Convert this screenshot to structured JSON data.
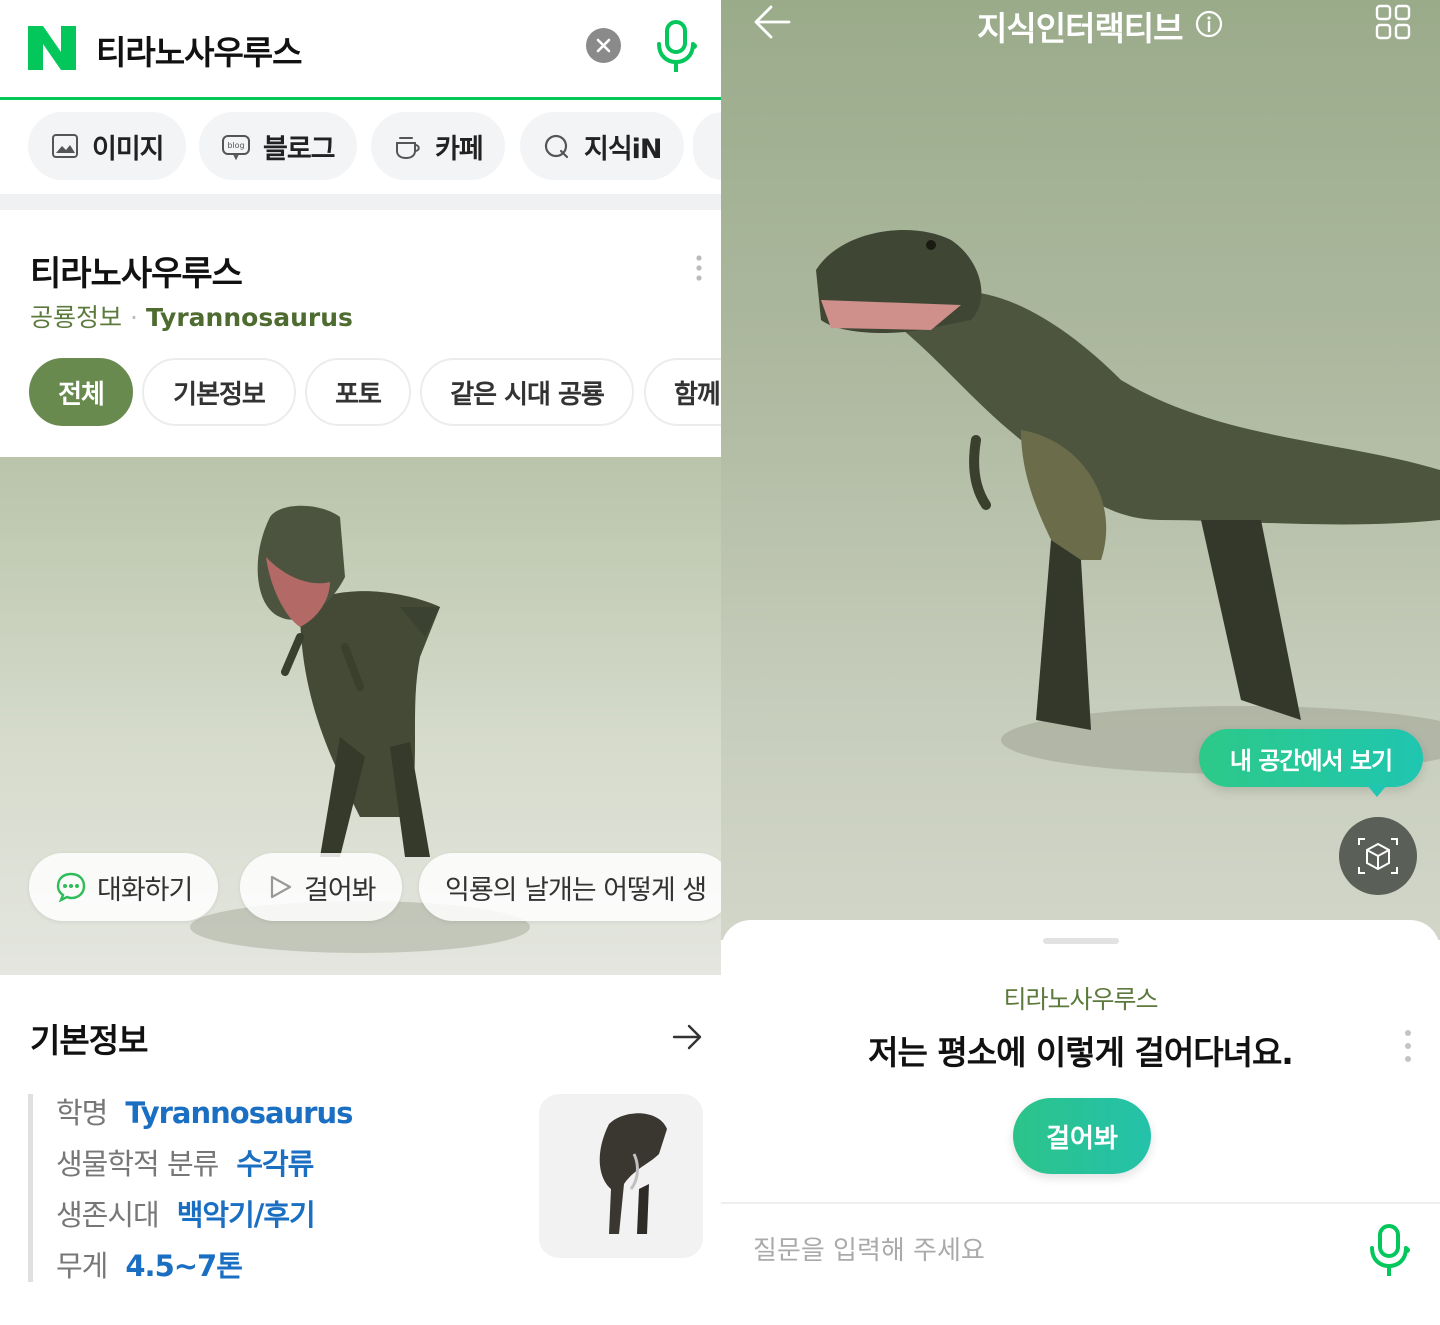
{
  "left": {
    "search": {
      "query": "티라노사우루스",
      "clear_icon": "close-icon",
      "mic_icon": "mic-icon"
    },
    "search_tabs": [
      {
        "label": "이미지",
        "icon": "image-icon"
      },
      {
        "label": "블로그",
        "icon": "blog-icon"
      },
      {
        "label": "카페",
        "icon": "cup-icon"
      },
      {
        "label": "지식iN",
        "icon": "q-icon"
      }
    ],
    "card": {
      "title": "티라노사우루스",
      "category": "공룡정보",
      "separator": "·",
      "english_name": "Tyrannosaurus",
      "tabs": [
        "전체",
        "기본정보",
        "포토",
        "같은 시대 공룡",
        "함께"
      ]
    },
    "dino_actions": [
      "대화하기",
      "걸어봐",
      "익룡의 날개는 어떻게 생"
    ],
    "basic_info": {
      "title": "기본정보",
      "rows": [
        {
          "key": "학명",
          "value": "Tyrannosaurus"
        },
        {
          "key": "생물학적 분류",
          "value": "수각류"
        },
        {
          "key": "생존시대",
          "value": "백악기/후기"
        },
        {
          "key": "무게",
          "value": "4.5~7톤"
        }
      ]
    }
  },
  "right": {
    "header": {
      "title": "지식인터랙티브"
    },
    "tooltip": "내 공간에서 보기",
    "sheet": {
      "name": "티라노사우루스",
      "message": "저는 평소에 이렇게 걸어다녀요.",
      "button": "걸어봐",
      "input_placeholder": "질문을 입력해 주세요"
    }
  },
  "colors": {
    "naver_green": "#03c75a",
    "accent_olive": "#698a4e",
    "link_blue": "#1b6fc2",
    "teal": "#24c2aa"
  }
}
